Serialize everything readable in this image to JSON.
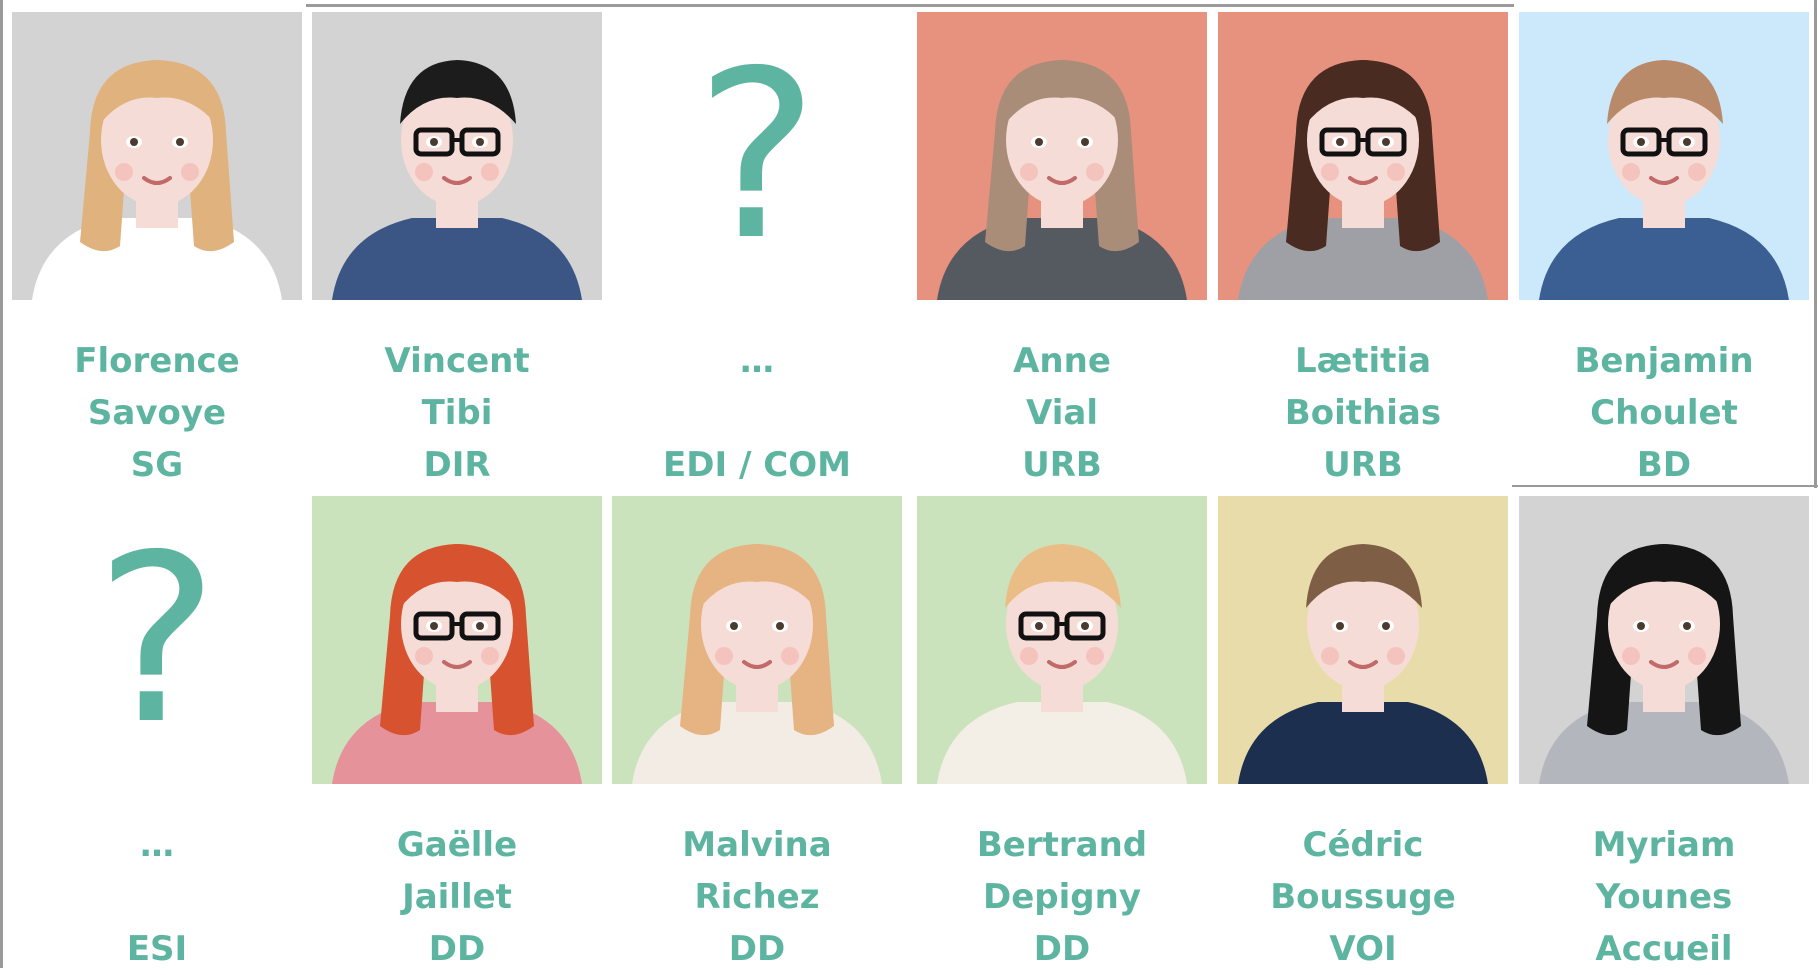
{
  "colors": {
    "text_accent": "#5db4a0",
    "bg_gray": "#d3d3d3",
    "bg_salmon": "#e6927f",
    "bg_blue": "#cce8fb",
    "bg_green": "#cbe3bd",
    "bg_yellow": "#e8dcaa"
  },
  "row1": [
    {
      "first": "Florence",
      "last": "Savoye",
      "dept": "SG",
      "bg": "#d3d3d3",
      "hair": "#e0b27e",
      "shirt": "#ffffff",
      "glasses": false,
      "icon": "avatar-woman-blonde"
    },
    {
      "first": "Vincent",
      "last": "Tibi",
      "dept": "DIR",
      "bg": "#d3d3d3",
      "hair": "#1c1c1c",
      "shirt": "#3b5584",
      "glasses": true,
      "icon": "avatar-man-dark-hair"
    },
    {
      "first": "…",
      "last": "",
      "dept": "EDI / COM",
      "unknown": true,
      "qmark": "?"
    },
    {
      "first": "Anne",
      "last": "Vial",
      "dept": "URB",
      "bg": "#e6927f",
      "hair": "#a98d78",
      "shirt": "#555a60",
      "glasses": false,
      "icon": "avatar-woman-long-hair"
    },
    {
      "first": "Lætitia",
      "last": "Boithias",
      "dept": "URB",
      "bg": "#e6927f",
      "hair": "#4a2b21",
      "shirt": "#9fa0a6",
      "glasses": true,
      "icon": "avatar-woman-dark-hair"
    },
    {
      "first": "Benjamin",
      "last": "Choulet",
      "dept": "BD",
      "bg": "#cce8fb",
      "hair": "#b88a6a",
      "shirt": "#3c5f93",
      "glasses": true,
      "icon": "avatar-man-plaid-shirt"
    }
  ],
  "row2": [
    {
      "first": "…",
      "last": "",
      "dept": "ESI",
      "unknown": true,
      "qmark": "?"
    },
    {
      "first": "Gaëlle",
      "last": "Jaillet",
      "dept": "DD",
      "bg": "#cbe3bd",
      "hair": "#d7522e",
      "shirt": "#e6929a",
      "glasses": true,
      "icon": "avatar-woman-red-hair"
    },
    {
      "first": "Malvina",
      "last": "Richez",
      "dept": "DD",
      "bg": "#cbe3bd",
      "hair": "#e6b383",
      "shirt": "#f2ece4",
      "glasses": false,
      "icon": "avatar-woman-strawberry-hair"
    },
    {
      "first": "Bertrand",
      "last": "Depigny",
      "dept": "DD",
      "bg": "#cbe3bd",
      "hair": "#ebbd86",
      "shirt": "#f4efe6",
      "glasses": true,
      "icon": "avatar-man-scarf"
    },
    {
      "first": "Cédric",
      "last": "Boussuge",
      "dept": "VOI",
      "bg": "#e8dcaa",
      "hair": "#7e5e44",
      "shirt": "#1d2f4f",
      "glasses": false,
      "icon": "avatar-man-jacket"
    },
    {
      "first": "Myriam",
      "last": "Younes",
      "dept": "Accueil",
      "bg": "#d3d3d3",
      "hair": "#151515",
      "shirt": "#b3b6bd",
      "glasses": false,
      "icon": "avatar-woman-black-hair"
    }
  ]
}
